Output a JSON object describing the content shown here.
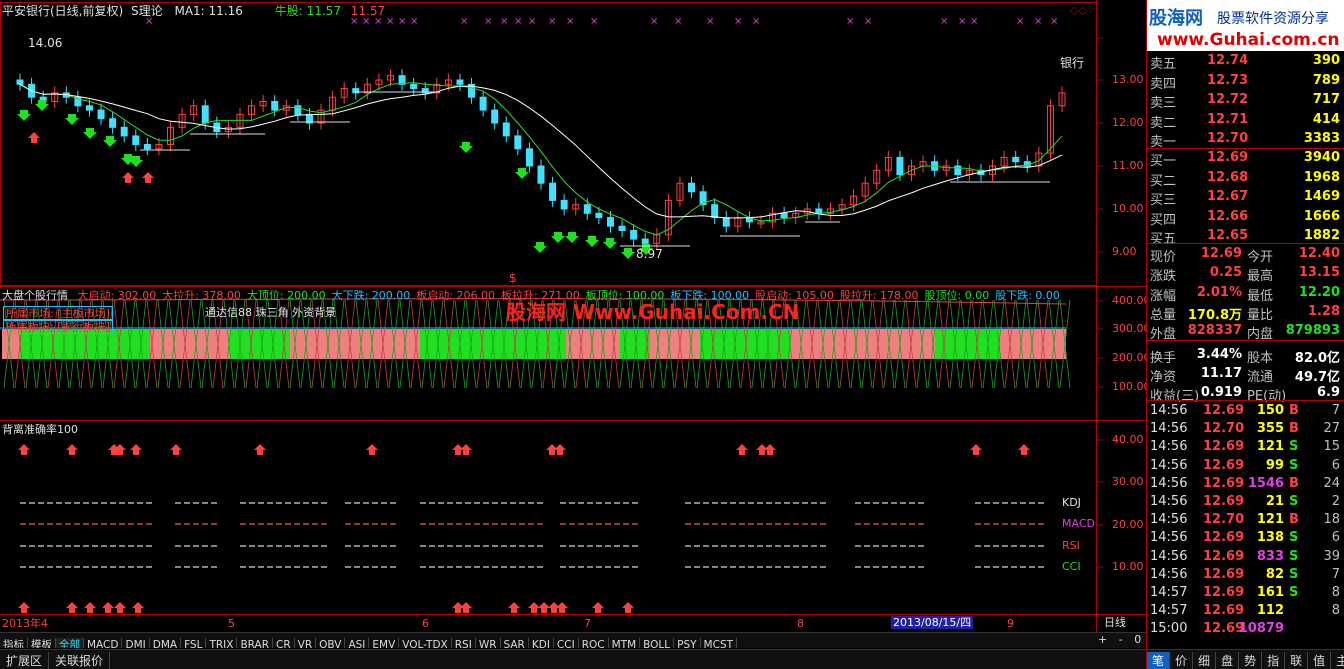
{
  "header": {
    "stock": "平安银行(日线,前复权)",
    "indicator": "S理论",
    "ma_label": "MA1: 11.16",
    "niu_label": "牛股:",
    "niu_v1": "11.57",
    "niu_v2": "11.57",
    "hi_label": "14.06",
    "lo_label": "8.97",
    "sector": "银行",
    "dollar": "$"
  },
  "price_axis": [
    "13.00",
    "12.00",
    "11.00",
    "10.00",
    "9.00"
  ],
  "panel2": {
    "title": "大盘个股行情",
    "items": [
      {
        "t": "大启动: 302.00",
        "c": "#ff4040"
      },
      {
        "t": "大拉升: 378.00",
        "c": "#ff4040"
      },
      {
        "t": "大顶位: 200.00",
        "c": "#20e020"
      },
      {
        "t": "大下跌: 200.00",
        "c": "#20c0ff"
      },
      {
        "t": "板启动: 206.00",
        "c": "#ff4040"
      },
      {
        "t": "板拉升: 271.00",
        "c": "#ff4040"
      },
      {
        "t": "板顶位: 100.00",
        "c": "#20e020"
      },
      {
        "t": "板下跌: 100.00",
        "c": "#20c0ff"
      },
      {
        "t": "股启动: 105.00",
        "c": "#ff4040"
      },
      {
        "t": "股拉升: 178.00",
        "c": "#ff4040"
      },
      {
        "t": "股顶位: 0.00",
        "c": "#20e020"
      },
      {
        "t": "股下跌: 0.00",
        "c": "#20c0ff"
      }
    ],
    "market_label": "所属市场: [主板市场]",
    "sector_label": "所属板块: [银行板块]",
    "note": "通达信88 珠三角 外资背景",
    "axis": [
      "400.00",
      "300.00",
      "200.00",
      "100.00"
    ]
  },
  "panel3": {
    "title": "背离准确率100",
    "axis": [
      "40.00",
      "30.00",
      "20.00",
      "10.00"
    ],
    "labels": [
      {
        "t": "KDJ",
        "c": "#e0e0e0"
      },
      {
        "t": "MACD",
        "c": "#e040e0"
      },
      {
        "t": "RSI",
        "c": "#ff4040"
      },
      {
        "t": "CCI",
        "c": "#20e020"
      }
    ]
  },
  "watermark": {
    "brand": "股海网",
    "url": "Www.Guhai.Com.CN"
  },
  "logo": {
    "brand": "股海网",
    "slogan": "股票软件资源分享",
    "url": "www.Guhai.com.cn"
  },
  "date_axis": {
    "labels": [
      "2013年4",
      "5",
      "6",
      "7",
      "8",
      "9"
    ],
    "cursor": "2013/08/15/四",
    "period": "日线"
  },
  "tabs": [
    "指标",
    "模板",
    "全部",
    "MACD",
    "DMI",
    "DMA",
    "FSL",
    "TRIX",
    "BRAR",
    "CR",
    "VR",
    "OBV",
    "ASI",
    "EMV",
    "VOL-TDX",
    "RSI",
    "WR",
    "SAR",
    "KDJ",
    "CCI",
    "ROC",
    "MTM",
    "BOLL",
    "PSY",
    "MCST"
  ],
  "bottom_tabs": [
    "扩展区",
    "关联报价"
  ],
  "scroll": {
    "plus": "+",
    "minus": "-",
    "zero": "0"
  },
  "quote": {
    "asks": [
      {
        "l": "卖五",
        "p": "12.74",
        "v": "390"
      },
      {
        "l": "卖四",
        "p": "12.73",
        "v": "789"
      },
      {
        "l": "卖三",
        "p": "12.72",
        "v": "717"
      },
      {
        "l": "卖二",
        "p": "12.71",
        "v": "414"
      },
      {
        "l": "卖一",
        "p": "12.70",
        "v": "3383"
      }
    ],
    "bids": [
      {
        "l": "买一",
        "p": "12.69",
        "v": "3940"
      },
      {
        "l": "买二",
        "p": "12.68",
        "v": "1968"
      },
      {
        "l": "买三",
        "p": "12.67",
        "v": "1469"
      },
      {
        "l": "买四",
        "p": "12.66",
        "v": "1666"
      },
      {
        "l": "买五",
        "p": "12.65",
        "v": "1882"
      }
    ],
    "stats": [
      [
        {
          "t": "现价",
          "c": "#c0c0c0"
        },
        {
          "t": "12.69",
          "c": "#ff4040"
        },
        {
          "t": "今开",
          "c": "#c0c0c0"
        },
        {
          "t": "12.40",
          "c": "#ff4040"
        }
      ],
      [
        {
          "t": "涨跌",
          "c": "#c0c0c0"
        },
        {
          "t": "0.25",
          "c": "#ff4040"
        },
        {
          "t": "最高",
          "c": "#c0c0c0"
        },
        {
          "t": "13.15",
          "c": "#ff4040"
        }
      ],
      [
        {
          "t": "涨幅",
          "c": "#c0c0c0"
        },
        {
          "t": "2.01%",
          "c": "#ff4040"
        },
        {
          "t": "最低",
          "c": "#c0c0c0"
        },
        {
          "t": "12.20",
          "c": "#20e020"
        }
      ],
      [
        {
          "t": "总量",
          "c": "#c0c0c0"
        },
        {
          "t": "170.8万",
          "c": "#ffff00"
        },
        {
          "t": "量比",
          "c": "#c0c0c0"
        },
        {
          "t": "1.28",
          "c": "#ff4040"
        }
      ],
      [
        {
          "t": "外盘",
          "c": "#c0c0c0"
        },
        {
          "t": "828337",
          "c": "#ff4040"
        },
        {
          "t": "内盘",
          "c": "#c0c0c0"
        },
        {
          "t": "879893",
          "c": "#20e020"
        }
      ],
      [
        {
          "t": "换手",
          "c": "#c0c0c0"
        },
        {
          "t": "3.44%",
          "c": "#ffffff"
        },
        {
          "t": "股本",
          "c": "#c0c0c0"
        },
        {
          "t": "82.0亿",
          "c": "#ffffff"
        }
      ],
      [
        {
          "t": "净资",
          "c": "#c0c0c0"
        },
        {
          "t": "11.17",
          "c": "#ffffff"
        },
        {
          "t": "流通",
          "c": "#c0c0c0"
        },
        {
          "t": "49.7亿",
          "c": "#ffffff"
        }
      ],
      [
        {
          "t": "收益(三)",
          "c": "#c0c0c0"
        },
        {
          "t": "0.919",
          "c": "#ffffff"
        },
        {
          "t": "PE(动)",
          "c": "#c0c0c0"
        },
        {
          "t": "6.9",
          "c": "#ffffff"
        }
      ]
    ],
    "ticks": [
      {
        "time": "14:56",
        "price": "12.69",
        "vol": "150",
        "bs": "B",
        "n": "7",
        "vc": "#ffff00"
      },
      {
        "time": "14:56",
        "price": "12.70",
        "vol": "355",
        "bs": "B",
        "n": "27",
        "vc": "#ffff00"
      },
      {
        "time": "14:56",
        "price": "12.69",
        "vol": "121",
        "bs": "S",
        "n": "15",
        "vc": "#ffff00"
      },
      {
        "time": "14:56",
        "price": "12.69",
        "vol": "99",
        "bs": "S",
        "n": "6",
        "vc": "#ffff00"
      },
      {
        "time": "14:56",
        "price": "12.69",
        "vol": "1546",
        "bs": "B",
        "n": "24",
        "vc": "#e040e0"
      },
      {
        "time": "14:56",
        "price": "12.69",
        "vol": "21",
        "bs": "S",
        "n": "2",
        "vc": "#ffff00"
      },
      {
        "time": "14:56",
        "price": "12.70",
        "vol": "121",
        "bs": "B",
        "n": "18",
        "vc": "#ffff00"
      },
      {
        "time": "14:56",
        "price": "12.69",
        "vol": "138",
        "bs": "S",
        "n": "6",
        "vc": "#ffff00"
      },
      {
        "time": "14:56",
        "price": "12.69",
        "vol": "833",
        "bs": "S",
        "n": "39",
        "vc": "#e040e0"
      },
      {
        "time": "14:56",
        "price": "12.69",
        "vol": "82",
        "bs": "S",
        "n": "7",
        "vc": "#ffff00"
      },
      {
        "time": "14:57",
        "price": "12.69",
        "vol": "161",
        "bs": "S",
        "n": "8",
        "vc": "#ffff00"
      },
      {
        "time": "14:57",
        "price": "12.69",
        "vol": "112",
        "bs": "",
        "n": "8",
        "vc": "#ffff00"
      },
      {
        "time": "15:00",
        "price": "12.69",
        "vol": "10879",
        "bs": "",
        "n": "",
        "vc": "#e040e0"
      }
    ],
    "bottom_tabs": [
      "笔",
      "价",
      "细",
      "盘",
      "势",
      "指",
      "联",
      "值",
      "主"
    ]
  }
}
